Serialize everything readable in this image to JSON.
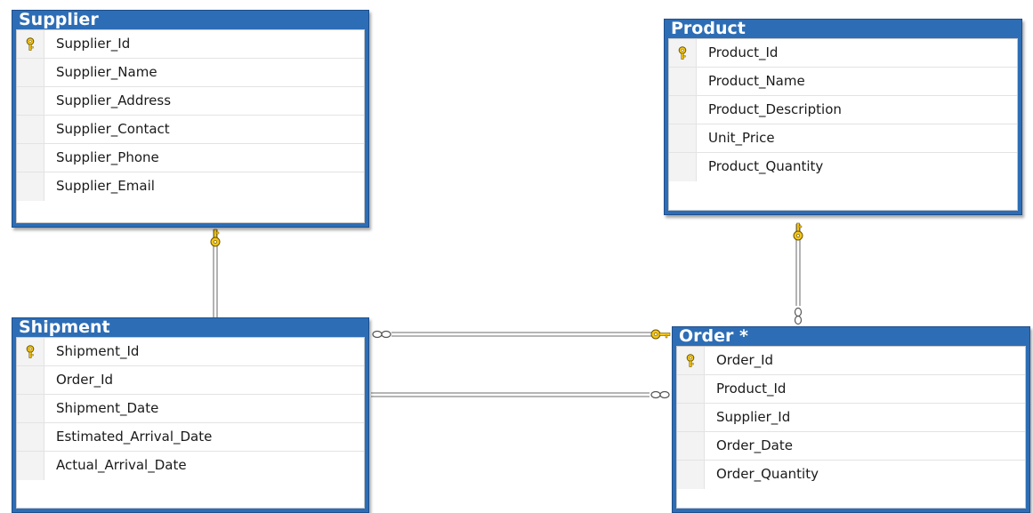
{
  "diagram": {
    "tables": {
      "supplier": {
        "title": "Supplier",
        "columns": [
          {
            "name": "Supplier_Id",
            "primary_key": true
          },
          {
            "name": "Supplier_Name",
            "primary_key": false
          },
          {
            "name": "Supplier_Address",
            "primary_key": false
          },
          {
            "name": "Supplier_Contact",
            "primary_key": false
          },
          {
            "name": "Supplier_Phone",
            "primary_key": false
          },
          {
            "name": "Supplier_Email",
            "primary_key": false
          }
        ]
      },
      "product": {
        "title": "Product",
        "columns": [
          {
            "name": "Product_Id",
            "primary_key": true
          },
          {
            "name": "Product_Name",
            "primary_key": false
          },
          {
            "name": "Product_Description",
            "primary_key": false
          },
          {
            "name": "Unit_Price",
            "primary_key": false
          },
          {
            "name": "Product_Quantity",
            "primary_key": false
          }
        ]
      },
      "shipment": {
        "title": "Shipment",
        "columns": [
          {
            "name": "Shipment_Id",
            "primary_key": true
          },
          {
            "name": "Order_Id",
            "primary_key": false
          },
          {
            "name": "Shipment_Date",
            "primary_key": false
          },
          {
            "name": "Estimated_Arrival_Date",
            "primary_key": false
          },
          {
            "name": "Actual_Arrival_Date",
            "primary_key": false
          }
        ]
      },
      "order": {
        "title": "Order *",
        "columns": [
          {
            "name": "Order_Id",
            "primary_key": true
          },
          {
            "name": "Product_Id",
            "primary_key": false
          },
          {
            "name": "Supplier_Id",
            "primary_key": false
          },
          {
            "name": "Order_Date",
            "primary_key": false
          },
          {
            "name": "Order_Quantity",
            "primary_key": false
          }
        ]
      }
    },
    "relationships": [
      {
        "from": "Supplier",
        "to": "Shipment",
        "one_end": "Supplier",
        "many_end": "Shipment"
      },
      {
        "from": "Product",
        "to": "Order",
        "one_end": "Product",
        "many_end": "Order"
      },
      {
        "from": "Shipment",
        "to": "Order",
        "one_end": "Order",
        "many_end": "Shipment"
      },
      {
        "from": "Shipment",
        "to": "Order",
        "one_end": "Shipment",
        "many_end": "Order"
      }
    ],
    "colors": {
      "table_header": "#2d6db5",
      "key_icon": "#f5c518",
      "connector": "#8a8a8a"
    }
  }
}
